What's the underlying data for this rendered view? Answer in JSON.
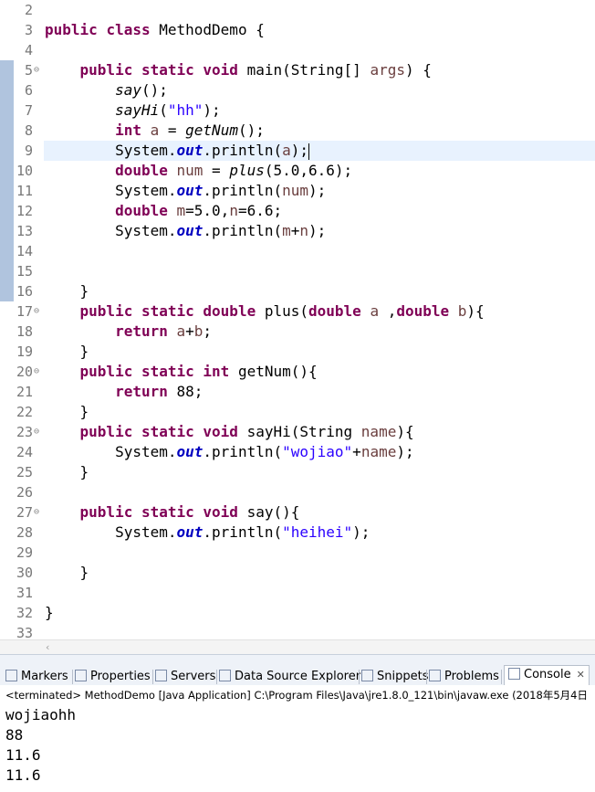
{
  "editor": {
    "current_line": "9",
    "lines": [
      {
        "num": "2",
        "tokens": []
      },
      {
        "num": "3",
        "tokens": [
          {
            "t": "public",
            "c": "kw"
          },
          {
            "t": " "
          },
          {
            "t": "class",
            "c": "kw"
          },
          {
            "t": " MethodDemo {"
          }
        ]
      },
      {
        "num": "4",
        "tokens": []
      },
      {
        "num": "5",
        "fold": "⊖",
        "tokens": [
          {
            "t": "    "
          },
          {
            "t": "public",
            "c": "kw"
          },
          {
            "t": " "
          },
          {
            "t": "static",
            "c": "kw"
          },
          {
            "t": " "
          },
          {
            "t": "void",
            "c": "kw"
          },
          {
            "t": " main(String[] "
          },
          {
            "t": "args",
            "c": "var"
          },
          {
            "t": ") {"
          }
        ]
      },
      {
        "num": "6",
        "tokens": [
          {
            "t": "        "
          },
          {
            "t": "say",
            "c": "st"
          },
          {
            "t": "();"
          }
        ]
      },
      {
        "num": "7",
        "tokens": [
          {
            "t": "        "
          },
          {
            "t": "sayHi",
            "c": "st"
          },
          {
            "t": "("
          },
          {
            "t": "\"hh\"",
            "c": "str"
          },
          {
            "t": ");"
          }
        ]
      },
      {
        "num": "8",
        "tokens": [
          {
            "t": "        "
          },
          {
            "t": "int",
            "c": "kw"
          },
          {
            "t": " "
          },
          {
            "t": "a",
            "c": "var"
          },
          {
            "t": " = "
          },
          {
            "t": "getNum",
            "c": "st"
          },
          {
            "t": "();"
          }
        ]
      },
      {
        "num": "9",
        "tokens": [
          {
            "t": "        System."
          },
          {
            "t": "out",
            "c": "fld"
          },
          {
            "t": ".println("
          },
          {
            "t": "a",
            "c": "var"
          },
          {
            "t": ");"
          }
        ]
      },
      {
        "num": "10",
        "tokens": [
          {
            "t": "        "
          },
          {
            "t": "double",
            "c": "kw"
          },
          {
            "t": " "
          },
          {
            "t": "num",
            "c": "var"
          },
          {
            "t": " = "
          },
          {
            "t": "plus",
            "c": "st"
          },
          {
            "t": "(5.0,6.6);"
          }
        ]
      },
      {
        "num": "11",
        "tokens": [
          {
            "t": "        System."
          },
          {
            "t": "out",
            "c": "fld"
          },
          {
            "t": ".println("
          },
          {
            "t": "num",
            "c": "var"
          },
          {
            "t": ");"
          }
        ]
      },
      {
        "num": "12",
        "tokens": [
          {
            "t": "        "
          },
          {
            "t": "double",
            "c": "kw"
          },
          {
            "t": " "
          },
          {
            "t": "m",
            "c": "var"
          },
          {
            "t": "=5.0,"
          },
          {
            "t": "n",
            "c": "var"
          },
          {
            "t": "=6.6;"
          }
        ]
      },
      {
        "num": "13",
        "tokens": [
          {
            "t": "        System."
          },
          {
            "t": "out",
            "c": "fld"
          },
          {
            "t": ".println("
          },
          {
            "t": "m",
            "c": "var"
          },
          {
            "t": "+"
          },
          {
            "t": "n",
            "c": "var"
          },
          {
            "t": ");"
          }
        ]
      },
      {
        "num": "14",
        "tokens": []
      },
      {
        "num": "15",
        "tokens": []
      },
      {
        "num": "16",
        "tokens": [
          {
            "t": "    }"
          }
        ]
      },
      {
        "num": "17",
        "fold": "⊖",
        "tokens": [
          {
            "t": "    "
          },
          {
            "t": "public",
            "c": "kw"
          },
          {
            "t": " "
          },
          {
            "t": "static",
            "c": "kw"
          },
          {
            "t": " "
          },
          {
            "t": "double",
            "c": "kw"
          },
          {
            "t": " plus("
          },
          {
            "t": "double",
            "c": "kw"
          },
          {
            "t": " "
          },
          {
            "t": "a",
            "c": "var"
          },
          {
            "t": " ,"
          },
          {
            "t": "double",
            "c": "kw"
          },
          {
            "t": " "
          },
          {
            "t": "b",
            "c": "var"
          },
          {
            "t": "){"
          }
        ]
      },
      {
        "num": "18",
        "tokens": [
          {
            "t": "        "
          },
          {
            "t": "return",
            "c": "kw"
          },
          {
            "t": " "
          },
          {
            "t": "a",
            "c": "var"
          },
          {
            "t": "+"
          },
          {
            "t": "b",
            "c": "var"
          },
          {
            "t": ";"
          }
        ]
      },
      {
        "num": "19",
        "tokens": [
          {
            "t": "    }"
          }
        ]
      },
      {
        "num": "20",
        "fold": "⊖",
        "tokens": [
          {
            "t": "    "
          },
          {
            "t": "public",
            "c": "kw"
          },
          {
            "t": " "
          },
          {
            "t": "static",
            "c": "kw"
          },
          {
            "t": " "
          },
          {
            "t": "int",
            "c": "kw"
          },
          {
            "t": " getNum(){"
          }
        ]
      },
      {
        "num": "21",
        "tokens": [
          {
            "t": "        "
          },
          {
            "t": "return",
            "c": "kw"
          },
          {
            "t": " 88;"
          }
        ]
      },
      {
        "num": "22",
        "tokens": [
          {
            "t": "    }"
          }
        ]
      },
      {
        "num": "23",
        "fold": "⊖",
        "tokens": [
          {
            "t": "    "
          },
          {
            "t": "public",
            "c": "kw"
          },
          {
            "t": " "
          },
          {
            "t": "static",
            "c": "kw"
          },
          {
            "t": " "
          },
          {
            "t": "void",
            "c": "kw"
          },
          {
            "t": " sayHi(String "
          },
          {
            "t": "name",
            "c": "var"
          },
          {
            "t": "){"
          }
        ]
      },
      {
        "num": "24",
        "tokens": [
          {
            "t": "        System."
          },
          {
            "t": "out",
            "c": "fld"
          },
          {
            "t": ".println("
          },
          {
            "t": "\"wojiao\"",
            "c": "str"
          },
          {
            "t": "+"
          },
          {
            "t": "name",
            "c": "var"
          },
          {
            "t": ");"
          }
        ]
      },
      {
        "num": "25",
        "tokens": [
          {
            "t": "    }"
          }
        ]
      },
      {
        "num": "26",
        "tokens": []
      },
      {
        "num": "27",
        "fold": "⊖",
        "tokens": [
          {
            "t": "    "
          },
          {
            "t": "public",
            "c": "kw"
          },
          {
            "t": " "
          },
          {
            "t": "static",
            "c": "kw"
          },
          {
            "t": " "
          },
          {
            "t": "void",
            "c": "kw"
          },
          {
            "t": " say(){"
          }
        ]
      },
      {
        "num": "28",
        "tokens": [
          {
            "t": "        System."
          },
          {
            "t": "out",
            "c": "fld"
          },
          {
            "t": ".println("
          },
          {
            "t": "\"heihei\"",
            "c": "str"
          },
          {
            "t": ");"
          }
        ]
      },
      {
        "num": "29",
        "tokens": []
      },
      {
        "num": "30",
        "tokens": [
          {
            "t": "    }"
          }
        ]
      },
      {
        "num": "31",
        "tokens": []
      },
      {
        "num": "32",
        "tokens": [
          {
            "t": "}"
          }
        ]
      },
      {
        "num": "33",
        "tokens": []
      }
    ]
  },
  "scroll_arrow": "‹",
  "view_tabs": [
    {
      "label": "Markers",
      "icon": "markers-icon"
    },
    {
      "label": "Properties",
      "icon": "properties-icon"
    },
    {
      "label": "Servers",
      "icon": "servers-icon"
    },
    {
      "label": "Data Source Explorer",
      "icon": "data-source-icon"
    },
    {
      "label": "Snippets",
      "icon": "snippets-icon"
    },
    {
      "label": "Problems",
      "icon": "problems-icon"
    },
    {
      "label": "Console",
      "icon": "console-icon",
      "active": true,
      "close": "✕"
    }
  ],
  "console": {
    "status": "<terminated> MethodDemo [Java Application] C:\\Program Files\\Java\\jre1.8.0_121\\bin\\javaw.exe (2018年5月4日",
    "output": [
      "wojiaohh",
      "88",
      "11.6",
      "11.6"
    ]
  },
  "colors": {
    "keyword": "#7f0055",
    "string": "#2a00ff",
    "field": "#0000c0",
    "current_line": "#e8f2fe"
  }
}
